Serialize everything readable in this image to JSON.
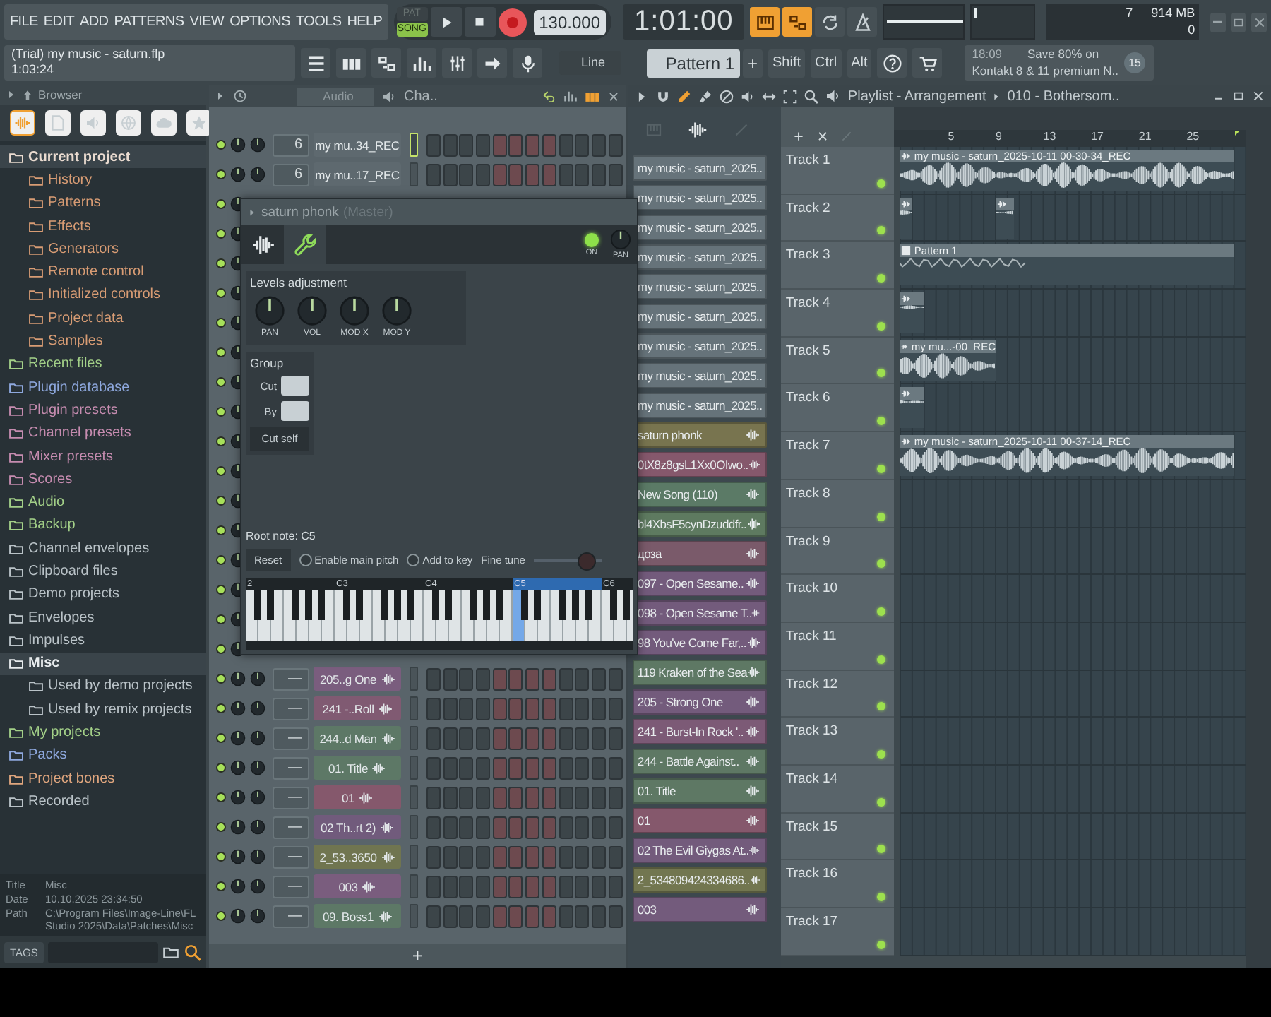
{
  "menu": [
    "FILE",
    "EDIT",
    "ADD",
    "PATTERNS",
    "VIEW",
    "OPTIONS",
    "TOOLS",
    "HELP"
  ],
  "transport": {
    "modes": [
      {
        "label": "PAT",
        "selected": false
      },
      {
        "label": "SONG",
        "selected": true
      }
    ],
    "tempo": "130.000",
    "time": "1:01:00"
  },
  "tool_buttons": [
    {
      "kind": "keyboard",
      "on": true
    },
    {
      "kind": "typing",
      "on": true
    },
    {
      "kind": "loop",
      "on": false
    },
    {
      "kind": "metronome",
      "on": false
    }
  ],
  "monitor": {
    "cpu": "7",
    "memory": "914 MB",
    "polyphony": "0"
  },
  "hint": {
    "title": "(Trial) my music - saturn.flp",
    "time": "1:03:24"
  },
  "snap": "Line",
  "pattern": "Pattern 1",
  "add_pattern": "+",
  "modifier_keys": [
    "Shift",
    "Ctrl",
    "Alt"
  ],
  "news": {
    "time": "18:09",
    "headline": "Save 80% on",
    "detail": "Kontakt 8 & 11 premium N..",
    "count": "15"
  },
  "browser": {
    "title": "Browser",
    "tabs": [
      {
        "kind": "wave",
        "selected": true
      },
      {
        "kind": "file",
        "selected": false
      },
      {
        "kind": "speaker",
        "selected": false
      },
      {
        "kind": "globe",
        "selected": false
      },
      {
        "kind": "cloud",
        "selected": false
      },
      {
        "kind": "star",
        "selected": false
      }
    ],
    "items": [
      {
        "label": "Current project",
        "color": "#eadbd0",
        "expanded": true,
        "children": [
          {
            "label": "History",
            "color": "#d89c74"
          },
          {
            "label": "Patterns",
            "color": "#d89c74"
          },
          {
            "label": "Effects",
            "color": "#d89c74"
          },
          {
            "label": "Generators",
            "color": "#d89c74"
          },
          {
            "label": "Remote control",
            "color": "#d89c74"
          },
          {
            "label": "Initialized controls",
            "color": "#d89c74"
          },
          {
            "label": "Project data",
            "color": "#d89c74"
          },
          {
            "label": "Samples",
            "color": "#d89c74"
          }
        ]
      },
      {
        "label": "Recent files",
        "color": "#a3d088",
        "expanded": false
      },
      {
        "label": "Plugin database",
        "color": "#8ea8de",
        "expanded": false
      },
      {
        "label": "Plugin presets",
        "color": "#c68cb0",
        "expanded": false
      },
      {
        "label": "Channel presets",
        "color": "#c68cb0",
        "expanded": false
      },
      {
        "label": "Mixer presets",
        "color": "#c68cb0",
        "expanded": false
      },
      {
        "label": "Scores",
        "color": "#c68cb0",
        "expanded": false
      },
      {
        "label": "Audio",
        "color": "#a3d088",
        "expanded": false
      },
      {
        "label": "Backup",
        "color": "#a3d088",
        "expanded": false
      },
      {
        "label": "Channel envelopes",
        "color": "#bac3c8",
        "expanded": false
      },
      {
        "label": "Clipboard files",
        "color": "#bac3c8",
        "expanded": false
      },
      {
        "label": "Demo projects",
        "color": "#bac3c8",
        "expanded": false
      },
      {
        "label": "Envelopes",
        "color": "#bac3c8",
        "expanded": false
      },
      {
        "label": "Impulses",
        "color": "#bac3c8",
        "expanded": false
      },
      {
        "label": "Misc",
        "color": "#e8ecee",
        "expanded": true,
        "children": [
          {
            "label": "Used by demo projects",
            "color": "#bac3c8"
          },
          {
            "label": "Used by remix projects",
            "color": "#bac3c8"
          }
        ]
      },
      {
        "label": "My projects",
        "color": "#a3d088",
        "expanded": false
      },
      {
        "label": "Packs",
        "color": "#8ea8de",
        "expanded": false
      },
      {
        "label": "Project bones",
        "color": "#e0a67e",
        "expanded": false
      },
      {
        "label": "Recorded",
        "color": "#bac3c8",
        "expanded": false
      }
    ],
    "info": [
      {
        "label": "Title",
        "value": "Misc"
      },
      {
        "label": "Date",
        "value": "10.10.2025 23:34:50"
      },
      {
        "label": "Path",
        "value": "C:\\Program Files\\Image-Line\\FL Studio 2025\\Data\\Patches\\Misc"
      }
    ],
    "tags": "TAGS"
  },
  "channel_rack": {
    "filter": "Audio",
    "title": "Cha..",
    "add": "+",
    "channels": [
      {
        "on": true,
        "track": "6",
        "name": "my mu..34_REC",
        "kind": "audio",
        "color": "#5e696f",
        "selected": true
      },
      {
        "on": true,
        "track": "6",
        "name": "my mu..17_REC",
        "kind": "audio",
        "color": "#5e696f",
        "selected": false
      },
      {
        "on": true
      },
      {
        "on": true
      },
      {
        "on": true
      },
      {
        "on": true
      },
      {
        "on": true
      },
      {
        "on": true
      },
      {
        "on": true
      },
      {
        "on": true
      },
      {
        "on": true
      },
      {
        "on": true
      },
      {
        "on": true
      },
      {
        "on": true
      },
      {
        "on": true
      },
      {
        "on": true
      },
      {
        "on": true
      },
      {
        "on": true
      },
      {
        "on": true,
        "track": "—",
        "name": "205..g One",
        "kind": "sampler",
        "color": "#7a5d7e",
        "selected": false
      },
      {
        "on": true,
        "track": "—",
        "name": "241 -..Roll",
        "kind": "sampler",
        "color": "#805a72",
        "selected": false
      },
      {
        "on": true,
        "track": "—",
        "name": "244..d Man",
        "kind": "sampler",
        "color": "#5d7866",
        "selected": false
      },
      {
        "on": true,
        "track": "—",
        "name": "01. Title",
        "kind": "sampler",
        "color": "#5d7866",
        "selected": false
      },
      {
        "on": true,
        "track": "—",
        "name": "01",
        "kind": "sampler",
        "color": "#85586c",
        "selected": false
      },
      {
        "on": true,
        "track": "—",
        "name": "02 Th..rt 2)",
        "kind": "sampler",
        "color": "#715b7c",
        "selected": false
      },
      {
        "on": true,
        "track": "—",
        "name": "2_53..3650",
        "kind": "sampler",
        "color": "#707550",
        "selected": false
      },
      {
        "on": true,
        "track": "—",
        "name": "003",
        "kind": "sampler",
        "color": "#7a5d7e",
        "selected": false
      },
      {
        "on": true,
        "track": "—",
        "name": "09. Boss1",
        "kind": "sampler",
        "color": "#5d7866",
        "selected": false
      }
    ]
  },
  "channel_settings": {
    "title": "saturn phonk",
    "subtitle": "(Master)",
    "tabs": [
      {
        "kind": "wave",
        "selected": false
      },
      {
        "kind": "wrench",
        "selected": true
      }
    ],
    "on": true,
    "on_label": "ON",
    "pan_label": "PAN",
    "levels": {
      "title": "Levels adjustment",
      "knobs": [
        "PAN",
        "VOL",
        "MOD X",
        "MOD Y"
      ]
    },
    "group": {
      "title": "Group",
      "fields": [
        "Cut",
        "By"
      ],
      "button": "Cut self"
    },
    "root_note": "Root note: C5",
    "reset": "Reset",
    "options": [
      {
        "label": "Enable main pitch",
        "checked": false
      },
      {
        "label": "Add to key",
        "checked": false
      }
    ],
    "fine_tune": {
      "label": "Fine tune",
      "level": 0.9
    },
    "keyboard": [
      {
        "label": "2",
        "root": false
      },
      {
        "label": "C3",
        "root": false
      },
      {
        "label": "C4",
        "root": false
      },
      {
        "label": "C5",
        "root": true
      },
      {
        "label": "C6",
        "root": false
      }
    ]
  },
  "playlist": {
    "title": "Playlist - Arrangement",
    "pattern": "010 - Bothersom..",
    "ruler": [
      "5",
      "9",
      "13",
      "17",
      "21",
      "25"
    ],
    "picker": [
      {
        "label": "my music - saturn_2025..",
        "kind": "audio",
        "color": "#66737a"
      },
      {
        "label": "my music - saturn_2025..",
        "kind": "audio",
        "color": "#66737a"
      },
      {
        "label": "my music - saturn_2025..",
        "kind": "audio",
        "color": "#66737a"
      },
      {
        "label": "my music - saturn_2025..",
        "kind": "audio",
        "color": "#66737a"
      },
      {
        "label": "my music - saturn_2025..",
        "kind": "audio",
        "color": "#66737a"
      },
      {
        "label": "my music - saturn_2025..",
        "kind": "audio",
        "color": "#66737a"
      },
      {
        "label": "my music - saturn_2025..",
        "kind": "audio",
        "color": "#66737a"
      },
      {
        "label": "my music - saturn_2025..",
        "kind": "audio",
        "color": "#66737a"
      },
      {
        "label": "my music - saturn_2025..",
        "kind": "audio",
        "color": "#66737a"
      },
      {
        "label": "saturn phonk",
        "kind": "channel",
        "color": "#78744f"
      },
      {
        "label": "0tX8z8gsL1Xx0OIwo..",
        "kind": "channel",
        "color": "#85586c"
      },
      {
        "label": "New Song (110)",
        "kind": "channel",
        "color": "#5b7a66"
      },
      {
        "label": "bl4XbsF5cynDzuddfr..",
        "kind": "channel",
        "color": "#5e7a60"
      },
      {
        "label": "доза",
        "kind": "channel",
        "color": "#7a5a6a"
      },
      {
        "label": "097 - Open Sesame..",
        "kind": "channel",
        "color": "#735b7c"
      },
      {
        "label": "098 - Open Sesame T..",
        "kind": "channel",
        "color": "#735b7c"
      },
      {
        "label": "98 You've Come Far,..",
        "kind": "channel",
        "color": "#735b7c"
      },
      {
        "label": "119 Kraken of the Sea",
        "kind": "channel",
        "color": "#5e7864"
      },
      {
        "label": "205 - Strong One",
        "kind": "channel",
        "color": "#735b7c"
      },
      {
        "label": "241 - Burst-In Rock '..",
        "kind": "channel",
        "color": "#7c5a76"
      },
      {
        "label": "244 - Battle Against..",
        "kind": "channel",
        "color": "#5e7864"
      },
      {
        "label": "01. Title",
        "kind": "channel",
        "color": "#5e7864"
      },
      {
        "label": "01",
        "kind": "channel",
        "color": "#85586c"
      },
      {
        "label": "02 The Evil Giygas At..",
        "kind": "channel",
        "color": "#735b7c"
      },
      {
        "label": "2_534809424334686..",
        "kind": "channel",
        "color": "#727650"
      },
      {
        "label": "003",
        "kind": "channel",
        "color": "#735b7c"
      }
    ],
    "tracks": [
      {
        "name": "Track 1",
        "on": true,
        "clips": [
          {
            "kind": "audio_long",
            "label": "my music - saturn_2025-10-11 00-30-34_REC"
          }
        ]
      },
      {
        "name": "Track 2",
        "on": true,
        "clips": [
          {
            "kind": "audio_tiny"
          },
          {
            "kind": "audio_tiny_late"
          }
        ]
      },
      {
        "name": "Track 3",
        "on": true,
        "clips": [
          {
            "kind": "pattern_long",
            "label": "Pattern 1"
          }
        ]
      },
      {
        "name": "Track 4",
        "on": true,
        "clips": [
          {
            "kind": "audio_short"
          }
        ]
      },
      {
        "name": "Track 5",
        "on": true,
        "clips": [
          {
            "kind": "audio_medium",
            "label": "my mu...-00_REC"
          }
        ]
      },
      {
        "name": "Track 6",
        "on": true,
        "clips": [
          {
            "kind": "audio_short"
          }
        ]
      },
      {
        "name": "Track 7",
        "on": true,
        "clips": [
          {
            "kind": "audio_long",
            "label": "my music - saturn_2025-10-11 00-37-14_REC"
          }
        ]
      },
      {
        "name": "Track 8",
        "on": true
      },
      {
        "name": "Track 9",
        "on": true
      },
      {
        "name": "Track 10",
        "on": true
      },
      {
        "name": "Track 11",
        "on": true
      },
      {
        "name": "Track 12",
        "on": true
      },
      {
        "name": "Track 13",
        "on": true
      },
      {
        "name": "Track 14",
        "on": true
      },
      {
        "name": "Track 15",
        "on": true
      },
      {
        "name": "Track 16",
        "on": true
      },
      {
        "name": "Track 17",
        "on": true
      }
    ]
  }
}
